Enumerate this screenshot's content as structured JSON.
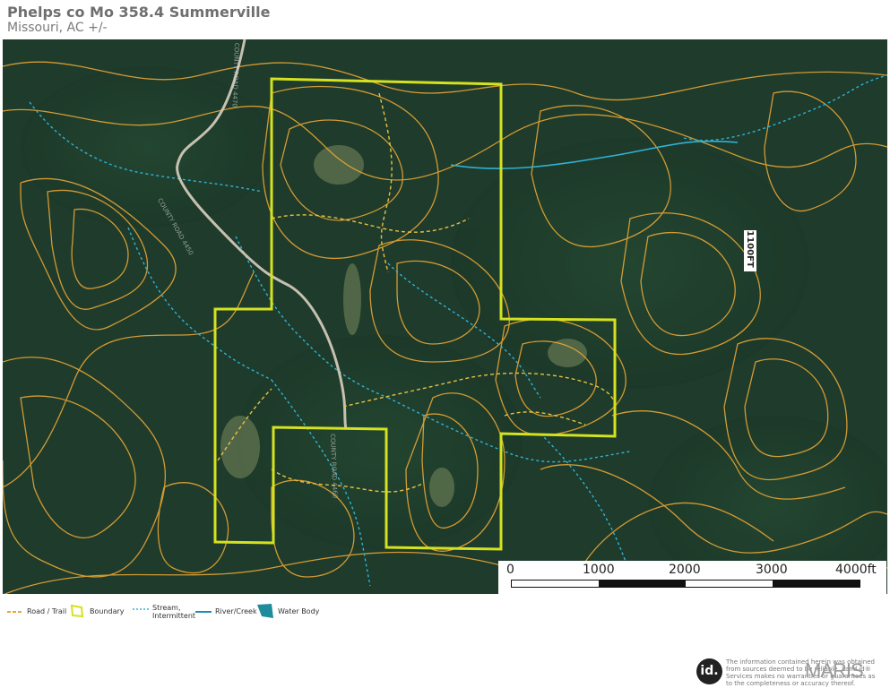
{
  "header": {
    "title": "Phelps co Mo 358.4 Summerville",
    "subtitle": "Missouri,  AC +/-"
  },
  "map": {
    "elevation_label": "1100FT",
    "road_labels": [
      "COUNTY ROAD 4450",
      "COUNTY ROAD 4460",
      "COUNTY ROAD 4470"
    ],
    "colors": {
      "forest": "#1f3a2a",
      "contour": "#e7a534",
      "boundary": "#d4e21f",
      "stream": "#2fb3d6",
      "road": "#d9cfc0"
    }
  },
  "scale_bar": {
    "labels": [
      "0",
      "1000",
      "2000",
      "3000",
      "4000ft"
    ]
  },
  "legend": {
    "items": [
      {
        "label": "Road / Trail",
        "icon": "dashed-line-icon"
      },
      {
        "label": "Boundary",
        "icon": "boundary-polygon-icon"
      },
      {
        "label": "Stream,\nIntermittent",
        "icon": "dotted-stream-icon"
      },
      {
        "label": "River/Creek",
        "icon": "river-line-icon"
      },
      {
        "label": "Water Body",
        "icon": "water-body-icon"
      }
    ]
  },
  "footer": {
    "logo_text": "id.",
    "disclaimer": "The information contained herein was obtained from sources deemed to be reliable. Land id® Services makes no warranties or guarantees as to the completeness or accuracy thereof.",
    "brand": "MARIS"
  }
}
